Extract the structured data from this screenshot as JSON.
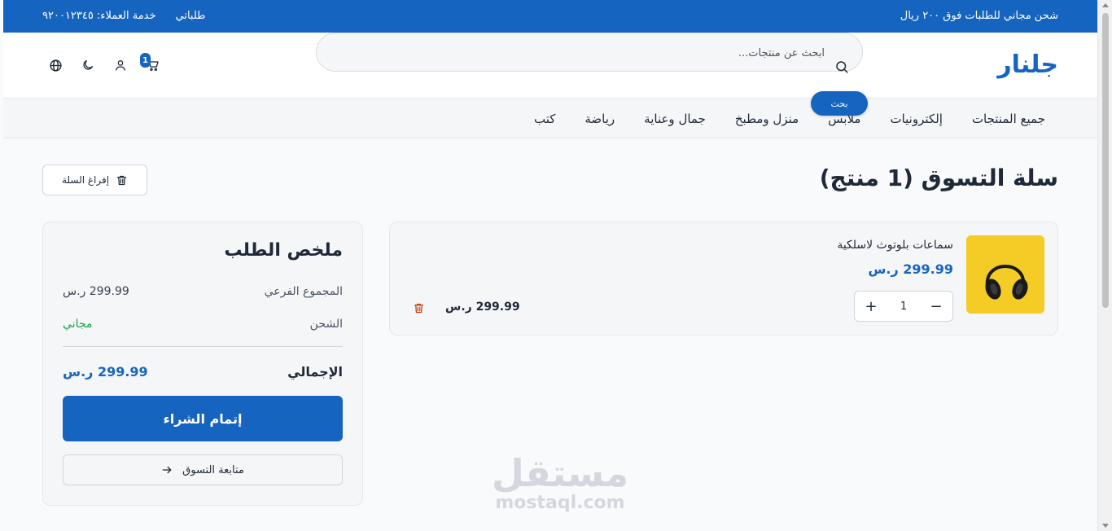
{
  "topbar": {
    "promo": "شحن مجاني للطلبات فوق ٢٠٠ ريال",
    "my_orders": "طلباتي",
    "customer_service": "خدمة العملاء: ٩٢٠٠١٢٣٤٥"
  },
  "header": {
    "logo": "جلنار",
    "search_placeholder": "ابحث عن منتجات...",
    "search_button": "بحث",
    "cart_count": "1"
  },
  "nav": {
    "items": [
      "جميع المنتجات",
      "إلكترونيات",
      "ملابس",
      "منزل ومطبخ",
      "جمال وعناية",
      "رياضة",
      "كتب"
    ]
  },
  "cart": {
    "title": "سلة التسوق (1 منتج)",
    "clear_label": "إفراغ السلة",
    "items": [
      {
        "name": "سماعات بلوتوث لاسلكية",
        "price": "299.99 ر.س",
        "quantity": "1",
        "line_total": "299.99 ر.س",
        "decrease": "−",
        "increase": "+"
      }
    ]
  },
  "summary": {
    "title": "ملخص الطلب",
    "subtotal_label": "المجموع الفرعي",
    "subtotal_value": "299.99 ر.س",
    "shipping_label": "الشحن",
    "shipping_value": "مجاني",
    "total_label": "الإجمالي",
    "total_value": "299.99 ر.س",
    "checkout_label": "إتمام الشراء",
    "continue_label": "متابعة التسوق"
  },
  "watermark": {
    "arabic": "مستقل",
    "latin": "mostaql.com"
  },
  "colors": {
    "primary": "#1565c0",
    "free_shipping": "#16a34a",
    "trash": "#c2410c",
    "product_bg": "#f5cc25"
  }
}
